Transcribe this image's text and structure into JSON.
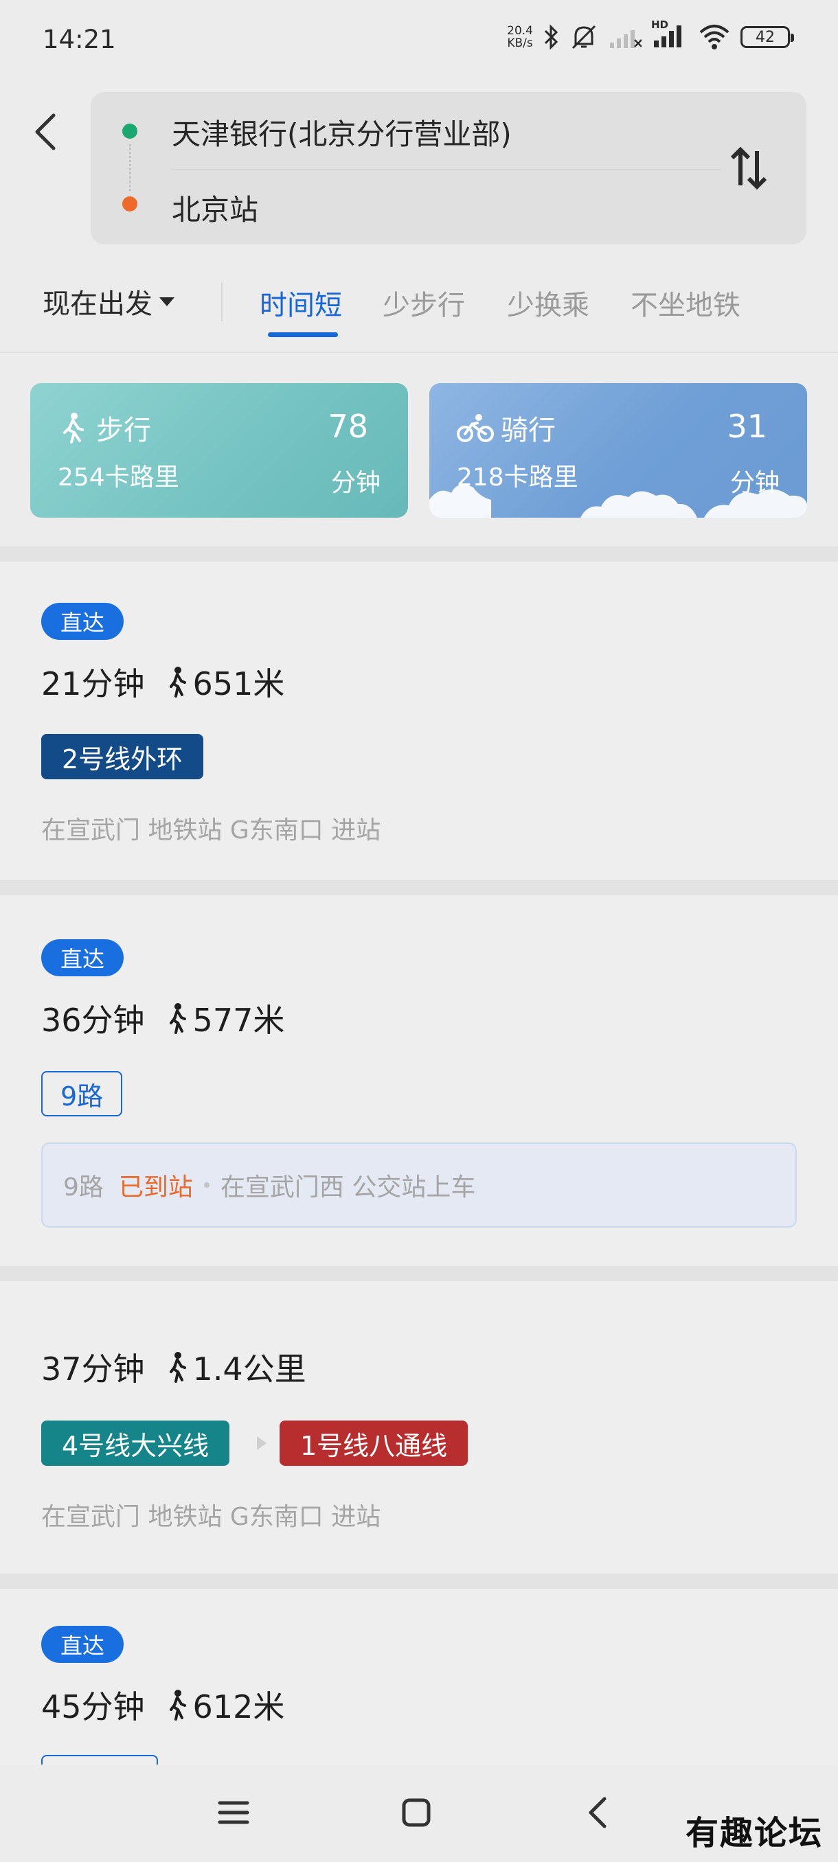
{
  "status_bar": {
    "time": "14:21",
    "net_speed_value": "20.4",
    "net_speed_unit": "KB/s",
    "hd_label": "HD",
    "battery": "42"
  },
  "route": {
    "from": "天津银行(北京分行营业部)",
    "to": "北京站",
    "from_dot_color": "#1ba870",
    "to_dot_color": "#ee6a2b"
  },
  "filters": {
    "depart_label": "现在出发",
    "tabs": [
      {
        "label": "时间短",
        "active": true
      },
      {
        "label": "少步行",
        "active": false
      },
      {
        "label": "少换乘",
        "active": false
      },
      {
        "label": "不坐地铁",
        "active": false
      }
    ]
  },
  "modes": {
    "walk": {
      "icon": "walk-icon",
      "label": "步行",
      "calories": "254卡路里",
      "value": "78",
      "unit": "分钟"
    },
    "ride": {
      "icon": "bicycle-icon",
      "label": "骑行",
      "calories": "218卡路里",
      "value": "31",
      "unit": "分钟"
    }
  },
  "plans": [
    {
      "badge": "直达",
      "time": "21分钟",
      "walk": "651米",
      "lines": [
        {
          "label": "2号线外环",
          "color": "#124b88"
        }
      ],
      "hint": "在宣武门 地铁站 G东南口 进站"
    },
    {
      "badge": "直达",
      "time": "36分钟",
      "walk": "577米",
      "lines": [
        {
          "label": "9路",
          "color": "#1767d6"
        }
      ],
      "bus_status": {
        "route": "9路",
        "status": "已到站",
        "boarding": "在宣武门西 公交站上车"
      }
    },
    {
      "time": "37分钟",
      "walk": "1.4公里",
      "lines": [
        {
          "label": "4号线大兴线",
          "color": "#158589"
        },
        {
          "label": "1号线八通线",
          "color": "#b82d2d"
        }
      ],
      "hint": "在宣武门 地铁站 G东南口 进站"
    },
    {
      "badge": "直达",
      "time": "45分钟",
      "walk": "612米"
    }
  ],
  "watermark": "有趣论坛",
  "colors": {
    "accent": "#1767d6",
    "direct_badge": "#1a6fe0",
    "arrived": "#e86a2c"
  }
}
